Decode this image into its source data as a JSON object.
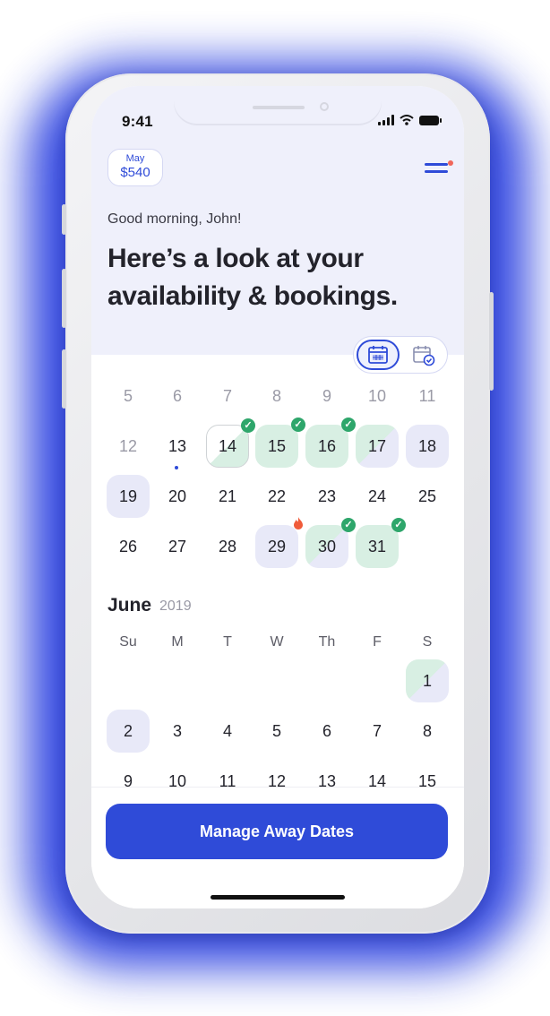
{
  "status_bar": {
    "time": "9:41"
  },
  "header": {
    "earnings_month": "May",
    "earnings_amount": "$540",
    "menu_icon": "hamburger-menu-icon",
    "greeting": "Good morning, John!",
    "headline_line1": "Here’s a look at your",
    "headline_line2": "availability & bookings."
  },
  "view_toggle": {
    "active": "calendar",
    "icons": [
      "calendar-icon",
      "calendar-check-icon"
    ]
  },
  "may_calendar": {
    "rows": [
      [
        {
          "d": "5",
          "s": "faded"
        },
        {
          "d": "6",
          "s": "faded"
        },
        {
          "d": "7",
          "s": "faded"
        },
        {
          "d": "8",
          "s": "faded"
        },
        {
          "d": "9",
          "s": "faded"
        },
        {
          "d": "10",
          "s": "faded"
        },
        {
          "d": "11",
          "s": "faded"
        }
      ],
      [
        {
          "d": "12",
          "s": "faded"
        },
        {
          "d": "13",
          "s": "today"
        },
        {
          "d": "14",
          "s": "split-w",
          "badge": "check"
        },
        {
          "d": "15",
          "s": "booked",
          "badge": "check"
        },
        {
          "d": "16",
          "s": "booked",
          "badge": "check"
        },
        {
          "d": "17",
          "s": "split"
        },
        {
          "d": "18",
          "s": "avail"
        }
      ],
      [
        {
          "d": "19",
          "s": "avail"
        },
        {
          "d": "20",
          "s": ""
        },
        {
          "d": "21",
          "s": ""
        },
        {
          "d": "22",
          "s": ""
        },
        {
          "d": "23",
          "s": ""
        },
        {
          "d": "24",
          "s": ""
        },
        {
          "d": "25",
          "s": ""
        }
      ],
      [
        {
          "d": "26",
          "s": ""
        },
        {
          "d": "27",
          "s": ""
        },
        {
          "d": "28",
          "s": ""
        },
        {
          "d": "29",
          "s": "avail",
          "badge": "fire"
        },
        {
          "d": "30",
          "s": "split",
          "badge": "check"
        },
        {
          "d": "31",
          "s": "booked",
          "badge": "check"
        }
      ]
    ]
  },
  "june_calendar": {
    "month": "June",
    "year": "2019",
    "weekdays": [
      "Su",
      "M",
      "T",
      "W",
      "Th",
      "F",
      "S"
    ],
    "rows": [
      [
        null,
        null,
        null,
        null,
        null,
        null,
        {
          "d": "1",
          "s": "split"
        }
      ],
      [
        {
          "d": "2",
          "s": "avail"
        },
        {
          "d": "3",
          "s": ""
        },
        {
          "d": "4",
          "s": ""
        },
        {
          "d": "5",
          "s": ""
        },
        {
          "d": "6",
          "s": ""
        },
        {
          "d": "7",
          "s": ""
        },
        {
          "d": "8",
          "s": ""
        }
      ],
      [
        {
          "d": "9",
          "s": ""
        },
        {
          "d": "10",
          "s": ""
        },
        {
          "d": "11",
          "s": ""
        },
        {
          "d": "12",
          "s": ""
        },
        {
          "d": "13",
          "s": ""
        },
        {
          "d": "14",
          "s": ""
        },
        {
          "d": "15",
          "s": ""
        }
      ]
    ]
  },
  "footer": {
    "cta_label": "Manage Away Dates"
  },
  "colors": {
    "accent": "#2f4bd8",
    "booked": "#d8efe3",
    "available": "#e8e9f8",
    "check": "#2ea66b",
    "fire": "#f05b3a"
  }
}
